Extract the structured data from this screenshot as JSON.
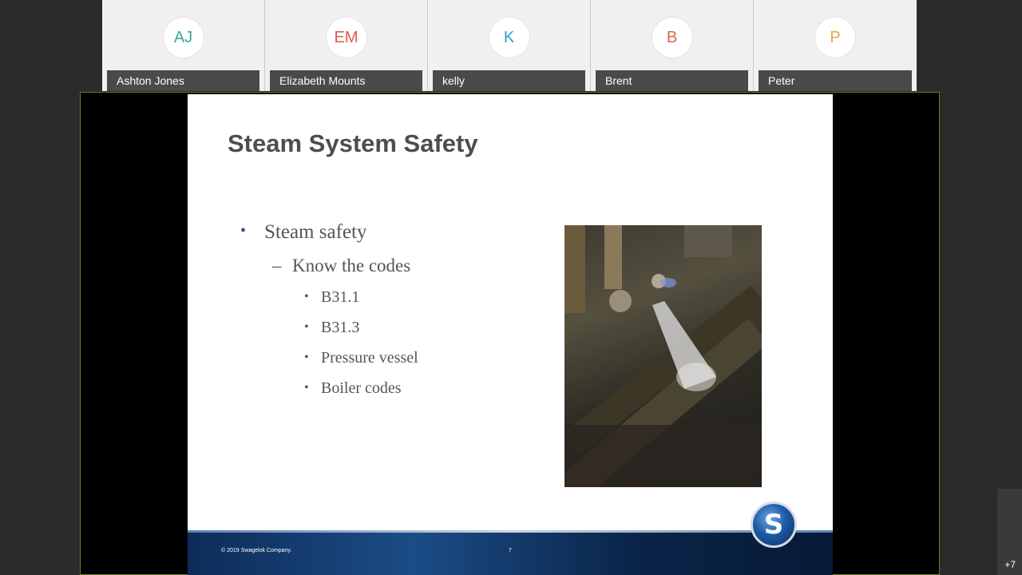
{
  "participants": [
    {
      "initials": "AJ",
      "name": "Ashton Jones",
      "color": "#3aa88f"
    },
    {
      "initials": "EM",
      "name": "Elizabeth Mounts",
      "color": "#e0584b"
    },
    {
      "initials": "K",
      "name": "kelly",
      "color": "#2f9fd8"
    },
    {
      "initials": "B",
      "name": "Brent",
      "color": "#e0644b"
    },
    {
      "initials": "P",
      "name": "Peter",
      "color": "#e8a53a"
    }
  ],
  "slide": {
    "title": "Steam System Safety",
    "bullet_l1": "Steam safety",
    "bullet_l2": "Know the codes",
    "bullets_l3": [
      "B31.1",
      "B31.3",
      "Pressure vessel",
      "Boiler codes"
    ],
    "copyright": "© 2019 Swagelok Company.",
    "page_number": "7",
    "logo_letter": "S"
  },
  "overflow": {
    "count_label": "+7"
  }
}
